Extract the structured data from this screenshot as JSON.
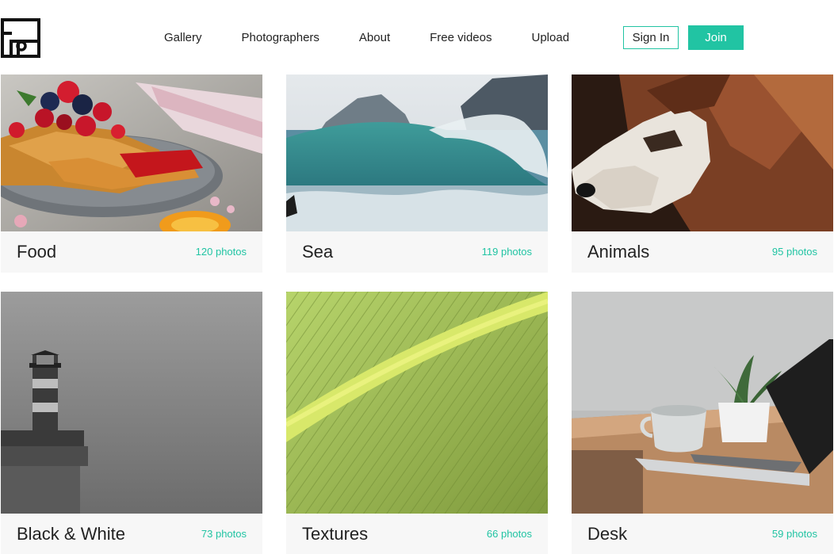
{
  "nav": {
    "items": [
      "Gallery",
      "Photographers",
      "About",
      "Free videos",
      "Upload"
    ],
    "signin_label": "Sign In",
    "join_label": "Join"
  },
  "brand": {
    "accent_color": "#21c4a3",
    "logo_icon": "camera-frame-logo-icon"
  },
  "categories": [
    {
      "name": "Food",
      "count": "120 photos",
      "image": "french-toast-with-berries"
    },
    {
      "name": "Sea",
      "count": "119 photos",
      "image": "ocean-wave-crashing"
    },
    {
      "name": "Animals",
      "count": "95 photos",
      "image": "dog-closeup"
    },
    {
      "name": "Black & White",
      "count": "73 photos",
      "image": "lighthouse-in-fog"
    },
    {
      "name": "Textures",
      "count": "66 photos",
      "image": "green-leaf-closeup"
    },
    {
      "name": "Desk",
      "count": "59 photos",
      "image": "laptop-coffee-plant-desk"
    }
  ]
}
